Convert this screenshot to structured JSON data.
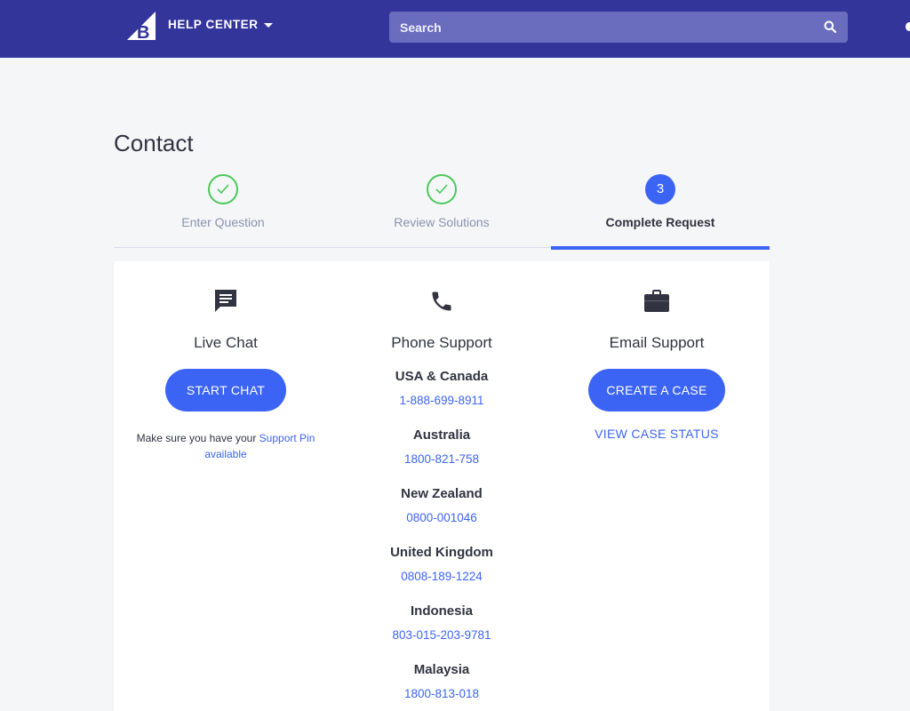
{
  "header": {
    "help_center_label": "HELP CENTER",
    "search_placeholder": "Search"
  },
  "page": {
    "title": "Contact"
  },
  "steps": [
    {
      "label": "Enter Question",
      "state": "complete"
    },
    {
      "label": "Review Solutions",
      "state": "complete"
    },
    {
      "label": "Complete Request",
      "state": "active",
      "number": "3"
    }
  ],
  "live_chat": {
    "title": "Live Chat",
    "button_label": "START CHAT",
    "note_prefix": "Make sure you have your ",
    "note_link": "Support Pin",
    "note_suffix": "available"
  },
  "phone_support": {
    "title": "Phone Support",
    "regions": [
      {
        "name": "USA & Canada",
        "number": "1-888-699-8911"
      },
      {
        "name": "Australia",
        "number": "1800-821-758"
      },
      {
        "name": "New Zealand",
        "number": "0800-001046"
      },
      {
        "name": "United Kingdom",
        "number": "0808-189-1224"
      },
      {
        "name": "Indonesia",
        "number": "803-015-203-9781"
      },
      {
        "name": "Malaysia",
        "number": "1800-813-018"
      }
    ]
  },
  "email_support": {
    "title": "Email Support",
    "button_label": "CREATE A CASE",
    "status_link": "VIEW CASE STATUS"
  },
  "colors": {
    "header_bg": "#34359b",
    "accent": "#3c64f4",
    "success": "#4cc85a",
    "page_bg": "#f4f6f8"
  },
  "icons": {
    "logo": "bigcommerce-logo-icon",
    "search": "search-icon",
    "chat": "chat-bubble-icon",
    "phone": "phone-icon",
    "email": "briefcase-icon",
    "check": "check-icon"
  }
}
